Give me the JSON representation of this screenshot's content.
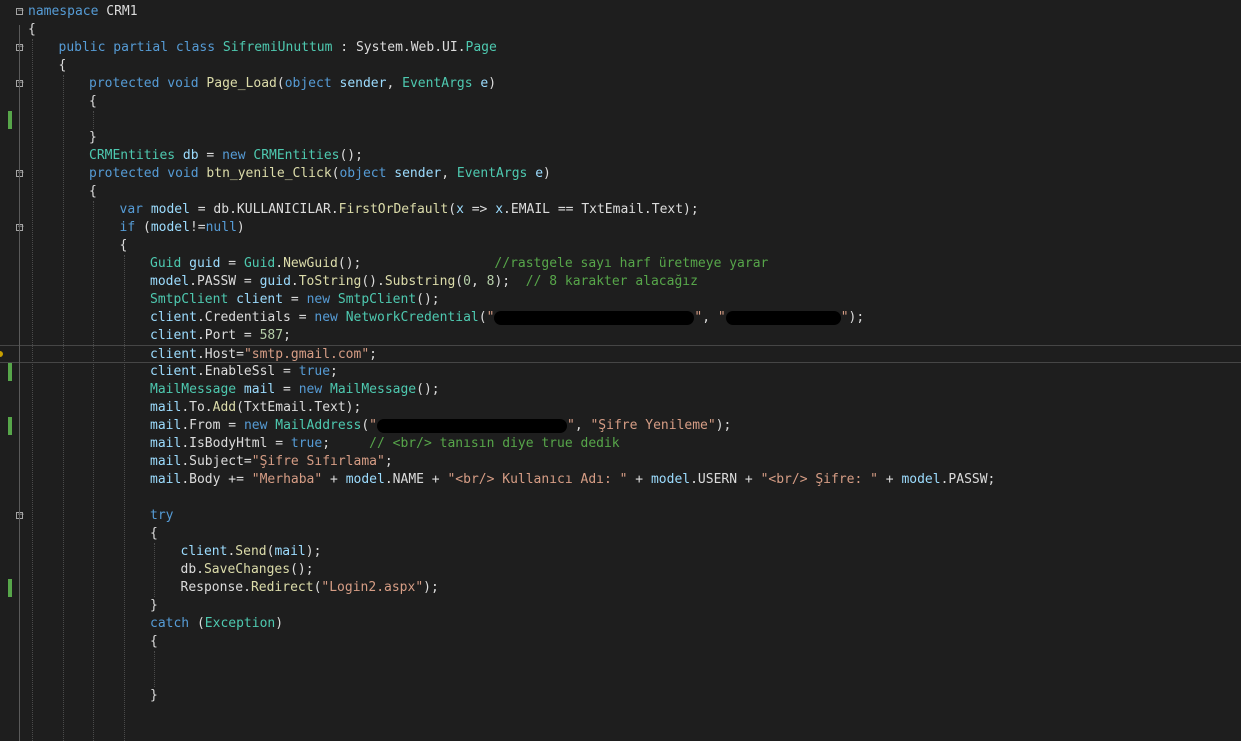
{
  "editor": {
    "lines": [
      {
        "indent": 0,
        "tokens": [
          [
            "kw",
            "namespace"
          ],
          [
            "pl",
            " "
          ],
          [
            "bi",
            "CRM1"
          ]
        ]
      },
      {
        "indent": 0,
        "tokens": [
          [
            "pl",
            "{"
          ]
        ]
      },
      {
        "indent": 1,
        "tokens": [
          [
            "kw",
            "public"
          ],
          [
            "pl",
            " "
          ],
          [
            "kw",
            "partial"
          ],
          [
            "pl",
            " "
          ],
          [
            "kw",
            "class"
          ],
          [
            "pl",
            " "
          ],
          [
            "ty",
            "SifremiUnuttum"
          ],
          [
            "pl",
            " : System.Web.UI."
          ],
          [
            "ty",
            "Page"
          ]
        ]
      },
      {
        "indent": 1,
        "tokens": [
          [
            "pl",
            "{"
          ]
        ]
      },
      {
        "indent": 2,
        "tokens": [
          [
            "kw",
            "protected"
          ],
          [
            "pl",
            " "
          ],
          [
            "kw",
            "void"
          ],
          [
            "pl",
            " "
          ],
          [
            "fn",
            "Page_Load"
          ],
          [
            "pl",
            "("
          ],
          [
            "kw",
            "object"
          ],
          [
            "pl",
            " "
          ],
          [
            "vr",
            "sender"
          ],
          [
            "pl",
            ", "
          ],
          [
            "ty",
            "EventArgs"
          ],
          [
            "pl",
            " "
          ],
          [
            "vr",
            "e"
          ],
          [
            "pl",
            ")"
          ]
        ]
      },
      {
        "indent": 2,
        "tokens": [
          [
            "pl",
            "{"
          ]
        ]
      },
      {
        "indent": 2,
        "tokens": []
      },
      {
        "indent": 2,
        "tokens": [
          [
            "pl",
            "}"
          ]
        ]
      },
      {
        "indent": 2,
        "tokens": [
          [
            "ty",
            "CRMEntities"
          ],
          [
            "pl",
            " "
          ],
          [
            "vr",
            "db"
          ],
          [
            "pl",
            " = "
          ],
          [
            "kw",
            "new"
          ],
          [
            "pl",
            " "
          ],
          [
            "ty",
            "CRMEntities"
          ],
          [
            "pl",
            "();"
          ]
        ]
      },
      {
        "indent": 2,
        "tokens": [
          [
            "kw",
            "protected"
          ],
          [
            "pl",
            " "
          ],
          [
            "kw",
            "void"
          ],
          [
            "pl",
            " "
          ],
          [
            "fn",
            "btn_yenile_Click"
          ],
          [
            "pl",
            "("
          ],
          [
            "kw",
            "object"
          ],
          [
            "pl",
            " "
          ],
          [
            "vr",
            "sender"
          ],
          [
            "pl",
            ", "
          ],
          [
            "ty",
            "EventArgs"
          ],
          [
            "pl",
            " "
          ],
          [
            "vr",
            "e"
          ],
          [
            "pl",
            ")"
          ]
        ]
      },
      {
        "indent": 2,
        "tokens": [
          [
            "pl",
            "{"
          ]
        ]
      },
      {
        "indent": 3,
        "tokens": [
          [
            "kw",
            "var"
          ],
          [
            "pl",
            " "
          ],
          [
            "vr",
            "model"
          ],
          [
            "pl",
            " = db.KULLANICILAR."
          ],
          [
            "fn",
            "FirstOrDefault"
          ],
          [
            "pl",
            "("
          ],
          [
            "vr",
            "x"
          ],
          [
            "pl",
            " => "
          ],
          [
            "vr",
            "x"
          ],
          [
            "pl",
            ".EMAIL == TxtEmail.Text);"
          ]
        ]
      },
      {
        "indent": 3,
        "tokens": [
          [
            "kw",
            "if"
          ],
          [
            "pl",
            " ("
          ],
          [
            "vr",
            "model"
          ],
          [
            "pl",
            "!="
          ],
          [
            "kw",
            "null"
          ],
          [
            "pl",
            ")"
          ]
        ]
      },
      {
        "indent": 3,
        "tokens": [
          [
            "pl",
            "{"
          ]
        ]
      },
      {
        "indent": 4,
        "tokens": [
          [
            "ty",
            "Guid"
          ],
          [
            "pl",
            " "
          ],
          [
            "vr",
            "guid"
          ],
          [
            "pl",
            " = "
          ],
          [
            "ty",
            "Guid"
          ],
          [
            "pl",
            "."
          ],
          [
            "fn",
            "NewGuid"
          ],
          [
            "pl",
            "();                 "
          ],
          [
            "cm",
            "//rastgele sayı harf üretmeye yarar"
          ]
        ]
      },
      {
        "indent": 4,
        "tokens": [
          [
            "vr",
            "model"
          ],
          [
            "pl",
            ".PASSW = "
          ],
          [
            "vr",
            "guid"
          ],
          [
            "pl",
            "."
          ],
          [
            "fn",
            "ToString"
          ],
          [
            "pl",
            "()."
          ],
          [
            "fn",
            "Substring"
          ],
          [
            "pl",
            "("
          ],
          [
            "nm",
            "0"
          ],
          [
            "pl",
            ", "
          ],
          [
            "nm",
            "8"
          ],
          [
            "pl",
            ");  "
          ],
          [
            "cm",
            "// 8 karakter alacağız"
          ]
        ]
      },
      {
        "indent": 4,
        "tokens": [
          [
            "ty",
            "SmtpClient"
          ],
          [
            "pl",
            " "
          ],
          [
            "vr",
            "client"
          ],
          [
            "pl",
            " = "
          ],
          [
            "kw",
            "new"
          ],
          [
            "pl",
            " "
          ],
          [
            "ty",
            "SmtpClient"
          ],
          [
            "pl",
            "();"
          ]
        ]
      },
      {
        "indent": 4,
        "tokens": [
          [
            "vr",
            "client"
          ],
          [
            "pl",
            ".Credentials = "
          ],
          [
            "kw",
            "new"
          ],
          [
            "pl",
            " "
          ],
          [
            "ty",
            "NetworkCredential"
          ],
          [
            "pl",
            "("
          ],
          [
            "st",
            "\""
          ],
          [
            "rd",
            "200"
          ],
          [
            "st",
            "\""
          ],
          [
            "pl",
            ", "
          ],
          [
            "st",
            "\""
          ],
          [
            "rd",
            "115"
          ],
          [
            "st",
            "\""
          ],
          [
            "pl",
            ");"
          ]
        ]
      },
      {
        "indent": 4,
        "tokens": [
          [
            "vr",
            "client"
          ],
          [
            "pl",
            ".Port = "
          ],
          [
            "nm",
            "587"
          ],
          [
            "pl",
            ";"
          ]
        ]
      },
      {
        "indent": 4,
        "tokens": [
          [
            "vr",
            "client"
          ],
          [
            "pl",
            ".Host="
          ],
          [
            "st",
            "\"smtp.gmail.com\""
          ],
          [
            "pl",
            ";"
          ]
        ]
      },
      {
        "indent": 4,
        "tokens": [
          [
            "vr",
            "client"
          ],
          [
            "pl",
            ".EnableSsl = "
          ],
          [
            "kw",
            "true"
          ],
          [
            "pl",
            ";"
          ]
        ]
      },
      {
        "indent": 4,
        "tokens": [
          [
            "ty",
            "MailMessage"
          ],
          [
            "pl",
            " "
          ],
          [
            "vr",
            "mail"
          ],
          [
            "pl",
            " = "
          ],
          [
            "kw",
            "new"
          ],
          [
            "pl",
            " "
          ],
          [
            "ty",
            "MailMessage"
          ],
          [
            "pl",
            "();"
          ]
        ]
      },
      {
        "indent": 4,
        "tokens": [
          [
            "vr",
            "mail"
          ],
          [
            "pl",
            ".To."
          ],
          [
            "fn",
            "Add"
          ],
          [
            "pl",
            "(TxtEmail.Text);"
          ]
        ]
      },
      {
        "indent": 4,
        "tokens": [
          [
            "vr",
            "mail"
          ],
          [
            "pl",
            ".From = "
          ],
          [
            "kw",
            "new"
          ],
          [
            "pl",
            " "
          ],
          [
            "ty",
            "MailAddress"
          ],
          [
            "pl",
            "("
          ],
          [
            "st",
            "\""
          ],
          [
            "rd",
            "190"
          ],
          [
            "st",
            "\""
          ],
          [
            "pl",
            ", "
          ],
          [
            "st",
            "\"Şifre Yenileme\""
          ],
          [
            "pl",
            ");"
          ]
        ]
      },
      {
        "indent": 4,
        "tokens": [
          [
            "vr",
            "mail"
          ],
          [
            "pl",
            ".IsBodyHtml = "
          ],
          [
            "kw",
            "true"
          ],
          [
            "pl",
            ";     "
          ],
          [
            "cm",
            "// <br/> tanısın diye true dedik"
          ]
        ]
      },
      {
        "indent": 4,
        "tokens": [
          [
            "vr",
            "mail"
          ],
          [
            "pl",
            ".Subject="
          ],
          [
            "st",
            "\"Şifre Sıfırlama\""
          ],
          [
            "pl",
            ";"
          ]
        ]
      },
      {
        "indent": 4,
        "tokens": [
          [
            "vr",
            "mail"
          ],
          [
            "pl",
            ".Body += "
          ],
          [
            "st",
            "\"Merhaba\""
          ],
          [
            "pl",
            " + "
          ],
          [
            "vr",
            "model"
          ],
          [
            "pl",
            ".NAME + "
          ],
          [
            "st",
            "\"<br/> Kullanıcı Adı: \""
          ],
          [
            "pl",
            " + "
          ],
          [
            "vr",
            "model"
          ],
          [
            "pl",
            ".USERN + "
          ],
          [
            "st",
            "\"<br/> Şifre: \""
          ],
          [
            "pl",
            " + "
          ],
          [
            "vr",
            "model"
          ],
          [
            "pl",
            ".PASSW;"
          ]
        ]
      },
      {
        "indent": 4,
        "tokens": []
      },
      {
        "indent": 4,
        "tokens": [
          [
            "kw",
            "try"
          ]
        ]
      },
      {
        "indent": 4,
        "tokens": [
          [
            "pl",
            "{"
          ]
        ]
      },
      {
        "indent": 5,
        "tokens": [
          [
            "vr",
            "client"
          ],
          [
            "pl",
            "."
          ],
          [
            "fn",
            "Send"
          ],
          [
            "pl",
            "("
          ],
          [
            "vr",
            "mail"
          ],
          [
            "pl",
            ");"
          ]
        ]
      },
      {
        "indent": 5,
        "tokens": [
          [
            "pl",
            "db."
          ],
          [
            "fn",
            "SaveChanges"
          ],
          [
            "pl",
            "();"
          ]
        ]
      },
      {
        "indent": 5,
        "tokens": [
          [
            "pl",
            "Response."
          ],
          [
            "fn",
            "Redirect"
          ],
          [
            "pl",
            "("
          ],
          [
            "st",
            "\"Login2.aspx\""
          ],
          [
            "pl",
            ");"
          ]
        ]
      },
      {
        "indent": 4,
        "tokens": [
          [
            "pl",
            "}"
          ]
        ]
      },
      {
        "indent": 4,
        "tokens": [
          [
            "kw",
            "catch"
          ],
          [
            "pl",
            " ("
          ],
          [
            "ty",
            "Exception"
          ],
          [
            "pl",
            ")"
          ]
        ]
      },
      {
        "indent": 4,
        "tokens": [
          [
            "pl",
            "{"
          ]
        ]
      },
      {
        "indent": 4,
        "tokens": []
      },
      {
        "indent": 4,
        "tokens": []
      },
      {
        "indent": 4,
        "tokens": [
          [
            "pl",
            "}"
          ]
        ]
      },
      {
        "indent": 4,
        "tokens": []
      },
      {
        "indent": 4,
        "tokens": []
      }
    ],
    "fold_lines": [
      0,
      2,
      4,
      9,
      12,
      28
    ],
    "change_lines": [
      6,
      20,
      23,
      32
    ],
    "current_line": 19,
    "colors": {
      "background": "#1e1e1e",
      "keyword": "#569cd6",
      "type": "#4ec9b0",
      "method": "#dcdcaa",
      "string": "#d69d85",
      "comment": "#57a64a",
      "number": "#b5cea8",
      "variable": "#9cdcfe",
      "plain": "#dcdcdc"
    }
  }
}
